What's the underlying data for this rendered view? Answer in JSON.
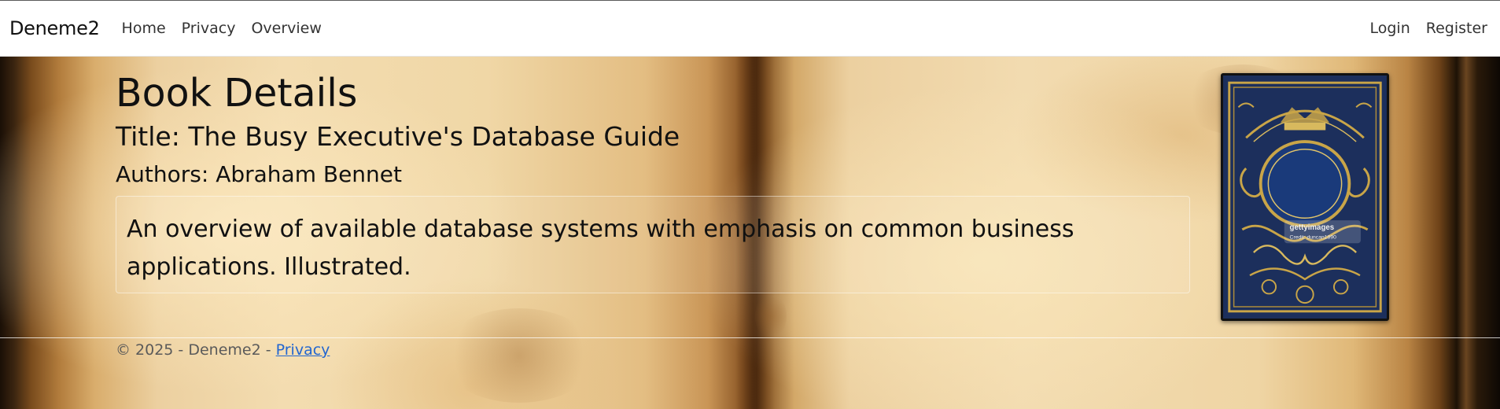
{
  "navbar": {
    "brand": "Deneme2",
    "links": [
      {
        "label": "Home"
      },
      {
        "label": "Privacy"
      },
      {
        "label": "Overview"
      }
    ],
    "auth": {
      "login": "Login",
      "register": "Register"
    }
  },
  "book": {
    "heading": "Book Details",
    "title_line": "Title: The Busy Executive's Database Guide",
    "authors_line": "Authors: Abraham Bennet",
    "description": "An overview of available database systems with emphasis on common business applications. Illustrated.",
    "cover": {
      "icon": "ornate-book-cover-image",
      "watermark_line1": "gettyimages",
      "watermark_line2": "Credit: duncan1890"
    }
  },
  "footer": {
    "text": "© 2025 - Deneme2 - ",
    "privacy_link": "Privacy"
  },
  "colors": {
    "cover_blue": "#1c2f5c",
    "cover_gold": "#c9a548",
    "link_blue": "#2266d0"
  }
}
